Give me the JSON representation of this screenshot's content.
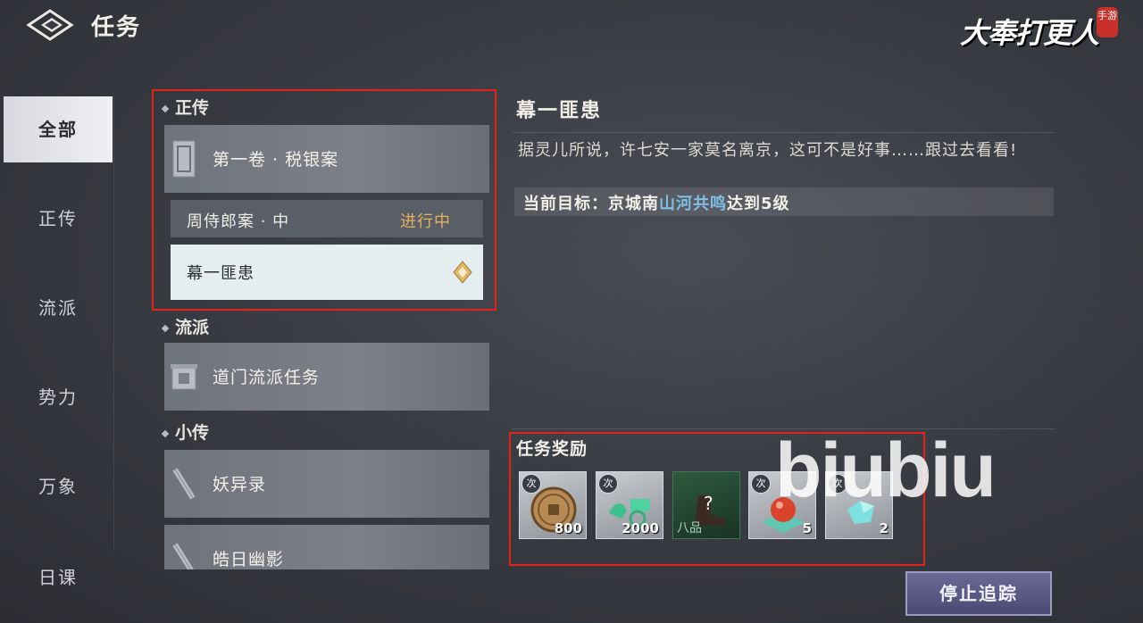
{
  "header": {
    "title": "任务",
    "logo_text": "大奉打更人",
    "logo_seal": "手游"
  },
  "sidenav": {
    "items": [
      {
        "label": "全部",
        "active": true
      },
      {
        "label": "正传",
        "active": false
      },
      {
        "label": "流派",
        "active": false
      },
      {
        "label": "势力",
        "active": false
      },
      {
        "label": "万象",
        "active": false
      },
      {
        "label": "日课",
        "active": false
      }
    ]
  },
  "quest_list": {
    "sections": [
      {
        "title": "正传",
        "cards": [
          {
            "label": "第一卷 · 税银案"
          }
        ],
        "sub_items": [
          {
            "label": "周侍郎案 · 中",
            "status": "进行中"
          },
          {
            "label": "幕一匪患",
            "status": "",
            "selected": true
          }
        ]
      },
      {
        "title": "流派",
        "cards": [
          {
            "label": "道门流派任务"
          }
        ]
      },
      {
        "title": "小传",
        "cards": [
          {
            "label": "妖异录"
          },
          {
            "label": "皓日幽影"
          }
        ]
      }
    ]
  },
  "detail": {
    "title": "幕一匪患",
    "description": "据灵儿所说，许七安一家莫名离京，这可不是好事……跟过去看看!",
    "goal_prefix": "当前目标：",
    "goal_part1": "京城南",
    "goal_link": "山河共鸣",
    "goal_part2": "达到5级"
  },
  "rewards": {
    "title": "任务奖励",
    "items": [
      {
        "icon": "coin-icon",
        "badge": "次",
        "qty": "800"
      },
      {
        "icon": "horse-carriage-icon",
        "badge": "次",
        "qty": "2000"
      },
      {
        "icon": "mystery-boot-icon",
        "badge": "",
        "qty": "",
        "grade": "八品"
      },
      {
        "icon": "red-orb-icon",
        "badge": "次",
        "qty": "5"
      },
      {
        "icon": "jade-crystal-icon",
        "badge": "次",
        "qty": "2"
      }
    ]
  },
  "watermark": "biubiu",
  "actions": {
    "stop_tracking": "停止追踪"
  },
  "colors": {
    "highlight": "#e2231a",
    "status_in_progress": "#e3b25c",
    "goal_link": "#7fc0e4"
  }
}
